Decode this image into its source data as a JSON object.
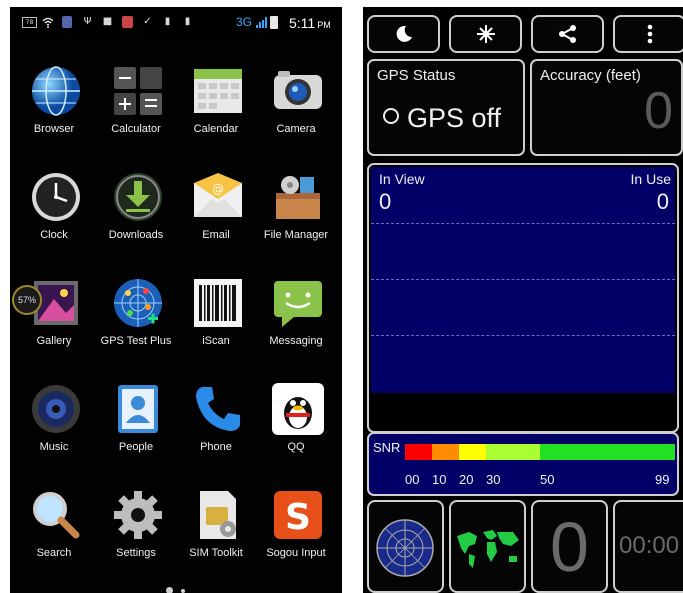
{
  "home": {
    "status": {
      "network": "3G",
      "time": "5:11",
      "ampm": "PM"
    },
    "apps": [
      {
        "label": "Browser",
        "icon": "globe-icon"
      },
      {
        "label": "Calculator",
        "icon": "calculator-icon"
      },
      {
        "label": "Calendar",
        "icon": "calendar-icon"
      },
      {
        "label": "Camera",
        "icon": "camera-icon"
      },
      {
        "label": "Clock",
        "icon": "clock-icon"
      },
      {
        "label": "Downloads",
        "icon": "download-icon"
      },
      {
        "label": "Email",
        "icon": "envelope-icon"
      },
      {
        "label": "File Manager",
        "icon": "folder-box-icon"
      },
      {
        "label": "Gallery",
        "icon": "gallery-icon"
      },
      {
        "label": "GPS Test Plus",
        "icon": "radar-globe-icon"
      },
      {
        "label": "iScan",
        "icon": "barcode-icon"
      },
      {
        "label": "Messaging",
        "icon": "message-bubble-icon"
      },
      {
        "label": "Music",
        "icon": "speaker-icon"
      },
      {
        "label": "People",
        "icon": "contact-card-icon"
      },
      {
        "label": "Phone",
        "icon": "phone-handset-icon"
      },
      {
        "label": "QQ",
        "icon": "penguin-icon"
      },
      {
        "label": "Search",
        "icon": "magnifier-icon"
      },
      {
        "label": "Settings",
        "icon": "gear-icon"
      },
      {
        "label": "SIM Toolkit",
        "icon": "sim-card-icon"
      },
      {
        "label": "Sogou Input",
        "icon": "sogou-s-icon"
      }
    ],
    "memory_badge": "57%"
  },
  "gps": {
    "toolbar": {
      "night_mode_icon": "moon-icon",
      "satellite_icon": "star-burst-icon",
      "share_icon": "share-icon",
      "menu_icon": "overflow-menu-icon"
    },
    "status_card": {
      "title": "GPS Status",
      "value": "GPS off"
    },
    "accuracy_card": {
      "title": "Accuracy (feet)",
      "value": "0"
    },
    "signal_panel": {
      "in_view_label": "In View",
      "in_view_value": "0",
      "in_use_label": "In Use",
      "in_use_value": "0"
    },
    "snr": {
      "label": "SNR",
      "ticks": [
        "00",
        "10",
        "20",
        "30",
        "50",
        "99"
      ],
      "colors": {
        "red": "#ff0000",
        "orange": "#ff8c00",
        "yellow": "#ffff00",
        "lime": "#aaff33",
        "green": "#22e022"
      }
    },
    "bottom": {
      "radar_icon": "sky-radar-icon",
      "map_icon": "world-map-icon",
      "count": "0",
      "timer": "00:00"
    }
  },
  "colors": {
    "panel_blue": "#000066",
    "accent_blue": "#38a8ff"
  }
}
